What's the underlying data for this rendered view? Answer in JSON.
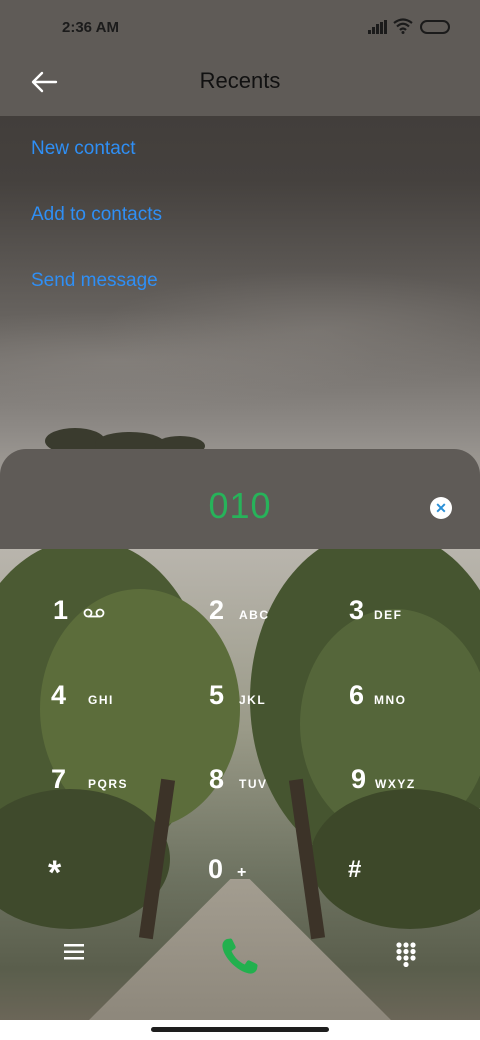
{
  "status_bar": {
    "time": "2:36 AM"
  },
  "header": {
    "title": "Recents"
  },
  "menu": {
    "items": [
      "New contact",
      "Add to contacts",
      "Send message"
    ]
  },
  "dialer": {
    "number": "010",
    "clear_symbol": "✕",
    "keys": [
      {
        "digit": "1",
        "letters": "",
        "icon": "voicemail-icon"
      },
      {
        "digit": "2",
        "letters": "ABC"
      },
      {
        "digit": "3",
        "letters": "DEF"
      },
      {
        "digit": "4",
        "letters": "GHI"
      },
      {
        "digit": "5",
        "letters": "JKL"
      },
      {
        "digit": "6",
        "letters": "MNO"
      },
      {
        "digit": "7",
        "letters": "PQRS"
      },
      {
        "digit": "8",
        "letters": "TUV"
      },
      {
        "digit": "9",
        "letters": "WXYZ"
      },
      {
        "digit": "*",
        "letters": ""
      },
      {
        "digit": "0",
        "letters": "+"
      },
      {
        "digit": "#",
        "letters": ""
      }
    ]
  },
  "colors": {
    "accent_blue": "#2f8ff5",
    "number_green": "#27b35a",
    "call_green": "#22b04e",
    "panel_gray": "#5f5b57"
  },
  "icons": [
    "back-arrow-icon",
    "signal-icon",
    "wifi-icon",
    "battery-icon",
    "voicemail-icon",
    "clear-icon",
    "menu-icon",
    "phone-icon",
    "dialpad-icon"
  ]
}
